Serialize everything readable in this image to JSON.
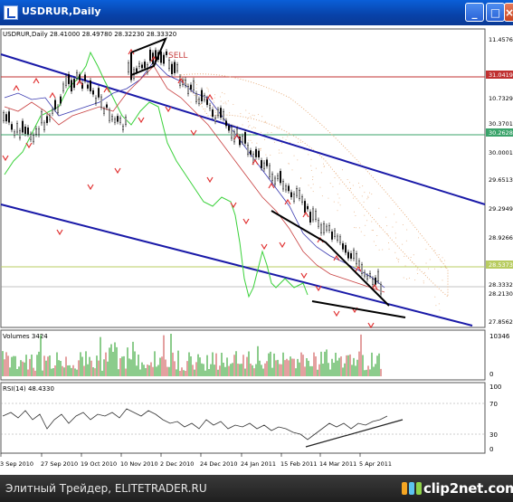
{
  "window": {
    "title": "USDRUR,Daily",
    "buttons": {
      "minimize": "_",
      "maximize": "□",
      "close": "×"
    }
  },
  "price_panel": {
    "header": "USDRUR,Daily  28.41000 28.49780 28.32230 28.33320",
    "price_labels": [
      "11.4576",
      "31.0419",
      "10.7329",
      "30.3701",
      "30.2628",
      "30.0001",
      "29.6513",
      "29.2949",
      "28.9266",
      "28.5373",
      "28.3332",
      "28.2130",
      "27.8562"
    ],
    "sell_label": "SELL"
  },
  "volume_panel": {
    "header": "Volumes 3424",
    "scale_top": "10346",
    "scale_bottom": "0"
  },
  "rsi_panel": {
    "header": "RSI(14) 48.4330",
    "scale": [
      "100",
      "70",
      "30",
      "0"
    ]
  },
  "x_axis": {
    "dates": [
      "3 Sep 2010",
      "27 Sep 2010",
      "19 Oct 2010",
      "10 Nov 2010",
      "2 Dec 2010",
      "24 Dec 2010",
      "24 Jan 2011",
      "15 Feb 2011",
      "14 Mar 2011",
      "5 Apr 2011"
    ]
  },
  "footer": {
    "caption": "Элитный Трейдер, ELITETRADER.RU",
    "logo_text": "clip2net.com"
  },
  "colors": {
    "titlebar": "#0842a8",
    "bull_marker": "#e03030",
    "channel": "#1a1aa8",
    "ichimoku": "#e8b080",
    "volume": "#1a9a1a",
    "red_level": "#c03030",
    "green_level": "#3aa36a"
  }
}
